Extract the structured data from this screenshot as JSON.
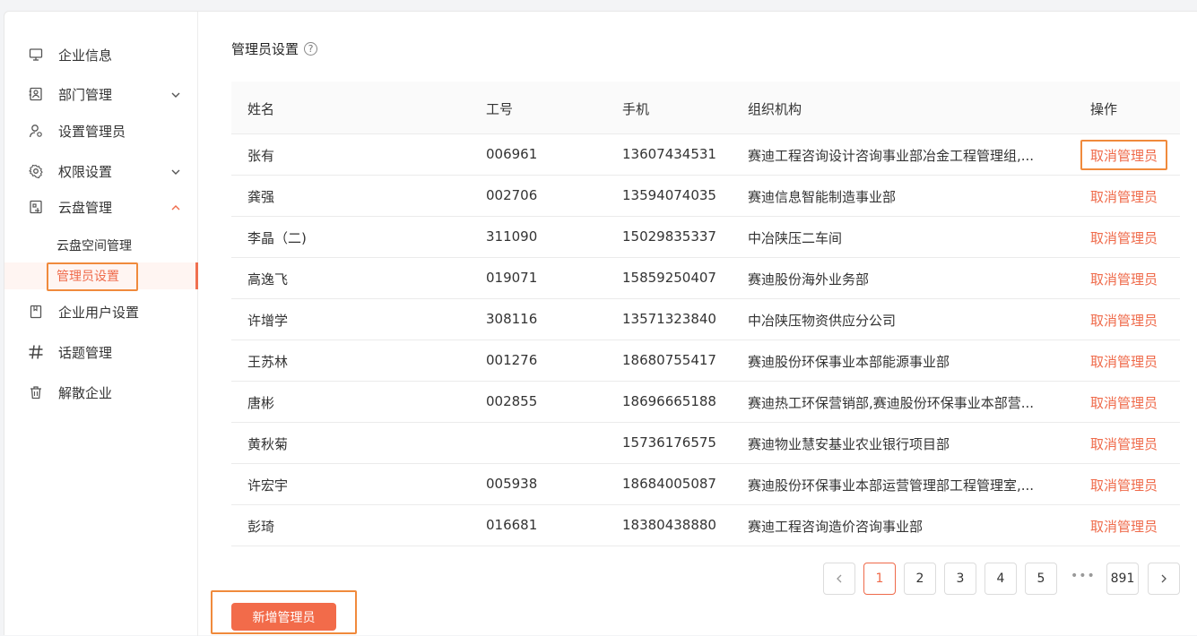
{
  "sidebar": {
    "items": [
      {
        "label": "企业信息",
        "icon": "monitor-icon"
      },
      {
        "label": "部门管理",
        "icon": "org-chart-icon",
        "chevron": "down"
      },
      {
        "label": "设置管理员",
        "icon": "user-admin-icon"
      },
      {
        "label": "权限设置",
        "icon": "gear-icon",
        "chevron": "down"
      },
      {
        "label": "云盘管理",
        "icon": "cloud-disk-icon",
        "chevron": "up"
      }
    ],
    "sub_items": [
      {
        "label": "云盘空间管理"
      },
      {
        "label": "管理员设置",
        "active": true
      }
    ],
    "items_after": [
      {
        "label": "企业用户设置",
        "icon": "book-icon"
      },
      {
        "label": "话题管理",
        "icon": "hash-icon"
      },
      {
        "label": "解散企业",
        "icon": "trash-icon"
      }
    ]
  },
  "main": {
    "title": "管理员设置",
    "help_icon": "?",
    "columns": {
      "name": "姓名",
      "id": "工号",
      "phone": "手机",
      "org": "组织机构",
      "op": "操作"
    },
    "rows": [
      {
        "name": "张有",
        "id": "006961",
        "phone": "13607434531",
        "org": "赛迪工程咨询设计咨询事业部冶金工程管理组,...",
        "op": "取消管理员"
      },
      {
        "name": "龚强",
        "id": "002706",
        "phone": "13594074035",
        "org": "赛迪信息智能制造事业部",
        "op": "取消管理员"
      },
      {
        "name": "李晶（二)",
        "id": "311090",
        "phone": "15029835337",
        "org": "中冶陕压二车间",
        "op": "取消管理员"
      },
      {
        "name": "高逸飞",
        "id": "019071",
        "phone": "15859250407",
        "org": "赛迪股份海外业务部",
        "op": "取消管理员"
      },
      {
        "name": "许增学",
        "id": "308116",
        "phone": "13571323840",
        "org": "中冶陕压物资供应分公司",
        "op": "取消管理员"
      },
      {
        "name": "王苏林",
        "id": "001276",
        "phone": "18680755417",
        "org": "赛迪股份环保事业本部能源事业部",
        "op": "取消管理员"
      },
      {
        "name": "唐彬",
        "id": "002855",
        "phone": "18696665188",
        "org": "赛迪热工环保营销部,赛迪股份环保事业本部营...",
        "op": "取消管理员"
      },
      {
        "name": "黄秋菊",
        "id": "",
        "phone": "15736176575",
        "org": "赛迪物业慧安基业农业银行项目部",
        "op": "取消管理员"
      },
      {
        "name": "许宏宇",
        "id": "005938",
        "phone": "18684005087",
        "org": "赛迪股份环保事业本部运营管理部工程管理室,...",
        "op": "取消管理员"
      },
      {
        "name": "彭琦",
        "id": "016681",
        "phone": "18380438880",
        "org": "赛迪工程咨询造价咨询事业部",
        "op": "取消管理员"
      }
    ],
    "pagination": {
      "pages": [
        "1",
        "2",
        "3",
        "4",
        "5"
      ],
      "current": "1",
      "ellipsis": "•••",
      "last": "891",
      "prev": "‹",
      "next": "›"
    },
    "add_button": "新增管理员"
  },
  "colors": {
    "accent": "#ef6a4a",
    "highlight_box": "#f08a3c"
  }
}
